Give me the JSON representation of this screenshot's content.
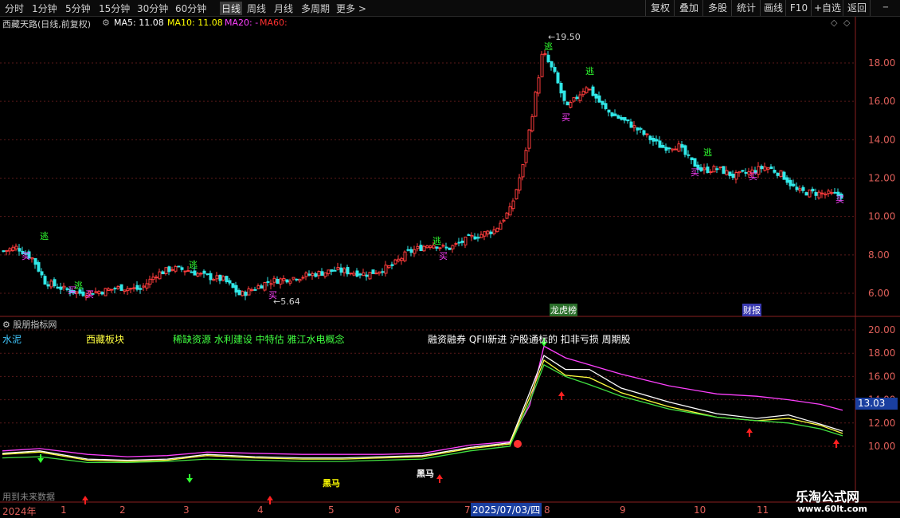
{
  "toolbar": {
    "timeframes": [
      "分时",
      "1分钟",
      "5分钟",
      "15分钟",
      "30分钟",
      "60分钟",
      "日线",
      "周线",
      "月线",
      "多周期",
      "更多"
    ],
    "active_timeframe": "日线",
    "right_buttons": [
      "复权",
      "叠加",
      "多股",
      "统计",
      "画线",
      "F10",
      "+自选",
      "返回"
    ],
    "minus_icon": "minus-icon",
    "more_chevron": ">"
  },
  "main_chart": {
    "stock_title": "西藏天路(日线,前复权)",
    "ma5_label": "MA5: 11.08",
    "ma10_label": "MA10: 11.08",
    "ma20_label": "MA20: -",
    "ma60_label": "MA60:",
    "ma_colors": {
      "ma5": "#ffffff",
      "ma10": "#ffff00",
      "ma20": "#ff00ff",
      "ma60": "#ff3030"
    },
    "high_marker": "19.50",
    "low_marker": "5.64",
    "tag_dragon": "龙虎榜",
    "tag_finance": "财报",
    "signal_escape": "逃",
    "signal_buy": "买"
  },
  "indicator": {
    "title": "股朋指标网",
    "concept_cement": "水泥",
    "concept_tibet": "西藏板块",
    "concept_list": "稀缺资源 水利建设 中特估 雅江水电概念",
    "concept_list2": "融资融券 QFII新进 沪股通标的 扣非亏损 周期股",
    "dark_horse": "黑马",
    "current_value": "13.03",
    "footer_note": "用到未来数据"
  },
  "date_axis": {
    "year_label": "2024年",
    "months": [
      "1",
      "2",
      "3",
      "4",
      "5",
      "6",
      "7",
      "8",
      "9",
      "10",
      "11"
    ],
    "cursor_date": "2025/07/03/四"
  },
  "watermark": {
    "name": "乐淘公式网",
    "url": "www.60lt.com"
  },
  "chart_data": [
    {
      "type": "candlestick",
      "title": "西藏天路(日线,前复权)",
      "ylim": [
        5.0,
        20.5
      ],
      "y_ticks": [
        6.0,
        8.0,
        10.0,
        12.0,
        14.0,
        16.0,
        18.0
      ],
      "close_path": [
        {
          "d": "2024-12",
          "c": 8.2
        },
        {
          "d": "2025-01-03",
          "c": 8.4
        },
        {
          "d": "2025-01-10",
          "c": 7.8
        },
        {
          "d": "2025-01-17",
          "c": 6.6
        },
        {
          "d": "2025-01-24",
          "c": 6.2
        },
        {
          "d": "2025-02-05",
          "c": 6.0
        },
        {
          "d": "2025-02-14",
          "c": 6.1
        },
        {
          "d": "2025-02-21",
          "c": 6.3
        },
        {
          "d": "2025-02-28",
          "c": 6.2
        },
        {
          "d": "2025-03-07",
          "c": 7.0
        },
        {
          "d": "2025-03-14",
          "c": 7.3
        },
        {
          "d": "2025-03-21",
          "c": 7.2
        },
        {
          "d": "2025-03-28",
          "c": 6.9
        },
        {
          "d": "2025-04-03",
          "c": 6.7
        },
        {
          "d": "2025-04-08",
          "c": 5.9
        },
        {
          "d": "2025-04-15",
          "c": 6.6
        },
        {
          "d": "2025-04-25",
          "c": 6.9
        },
        {
          "d": "2025-05-09",
          "c": 7.2
        },
        {
          "d": "2025-05-23",
          "c": 7.0
        },
        {
          "d": "2025-06-06",
          "c": 7.4
        },
        {
          "d": "2025-06-13",
          "c": 8.1
        },
        {
          "d": "2025-06-20",
          "c": 8.6
        },
        {
          "d": "2025-06-27",
          "c": 8.3
        },
        {
          "d": "2025-07-03",
          "c": 8.9
        },
        {
          "d": "2025-07-10",
          "c": 9.3
        },
        {
          "d": "2025-07-14",
          "c": 10.4
        },
        {
          "d": "2025-07-18",
          "c": 12.6
        },
        {
          "d": "2025-07-23",
          "c": 15.6
        },
        {
          "d": "2025-07-25",
          "c": 18.6
        },
        {
          "d": "2025-07-29",
          "c": 17.4
        },
        {
          "d": "2025-08-05",
          "c": 15.6
        },
        {
          "d": "2025-08-12",
          "c": 16.8
        },
        {
          "d": "2025-08-19",
          "c": 15.5
        },
        {
          "d": "2025-08-26",
          "c": 14.8
        },
        {
          "d": "2025-09-02",
          "c": 14.2
        },
        {
          "d": "2025-09-09",
          "c": 13.6
        },
        {
          "d": "2025-09-16",
          "c": 13.7
        },
        {
          "d": "2025-09-23",
          "c": 12.9
        },
        {
          "d": "2025-09-30",
          "c": 12.4
        },
        {
          "d": "2025-10-10",
          "c": 12.5
        },
        {
          "d": "2025-10-17",
          "c": 12.1
        },
        {
          "d": "2025-10-24",
          "c": 12.3
        },
        {
          "d": "2025-10-31",
          "c": 12.6
        },
        {
          "d": "2025-11-07",
          "c": 12.2
        },
        {
          "d": "2025-11-14",
          "c": 11.3
        },
        {
          "d": "2025-11-21",
          "c": 11.2
        },
        {
          "d": "2025-11-28",
          "c": 11.08
        }
      ],
      "high": 19.5,
      "low": 5.64
    },
    {
      "type": "line",
      "title": "股朋指标网",
      "ylim": [
        9.0,
        20.5
      ],
      "y_ticks": [
        10.0,
        12.0,
        14.0,
        16.0,
        18.0,
        20.0
      ],
      "series": [
        {
          "color": "#ff40ff",
          "values": [
            9.6,
            9.8,
            9.3,
            9.1,
            9.2,
            9.5,
            9.4,
            9.3,
            9.3,
            9.3,
            9.4,
            10.1,
            10.4,
            13.5,
            18.6,
            17.6,
            17.0,
            16.2,
            15.2,
            14.5,
            14.3,
            14.0,
            13.6,
            13.1
          ]
        },
        {
          "color": "#ffffff",
          "values": [
            9.4,
            9.6,
            8.9,
            8.8,
            8.9,
            9.3,
            9.1,
            9.0,
            9.0,
            9.1,
            9.2,
            9.9,
            10.3,
            14.6,
            17.8,
            16.6,
            16.6,
            15.0,
            13.8,
            12.8,
            12.4,
            12.7,
            11.9,
            11.3
          ]
        },
        {
          "color": "#ffff40",
          "values": [
            9.3,
            9.5,
            8.8,
            8.7,
            8.8,
            9.2,
            9.0,
            8.9,
            8.9,
            9.0,
            9.1,
            9.8,
            10.2,
            14.2,
            17.4,
            16.1,
            15.9,
            14.6,
            13.4,
            12.5,
            12.2,
            12.4,
            11.8,
            11.1
          ]
        },
        {
          "color": "#40e040",
          "values": [
            9.0,
            9.1,
            8.6,
            8.6,
            8.7,
            8.9,
            8.8,
            8.7,
            8.7,
            8.8,
            8.9,
            9.6,
            10.0,
            13.8,
            17.0,
            16.0,
            15.3,
            14.3,
            13.2,
            12.5,
            12.2,
            12.0,
            11.5,
            10.9
          ]
        }
      ],
      "current_value": 13.03
    }
  ]
}
